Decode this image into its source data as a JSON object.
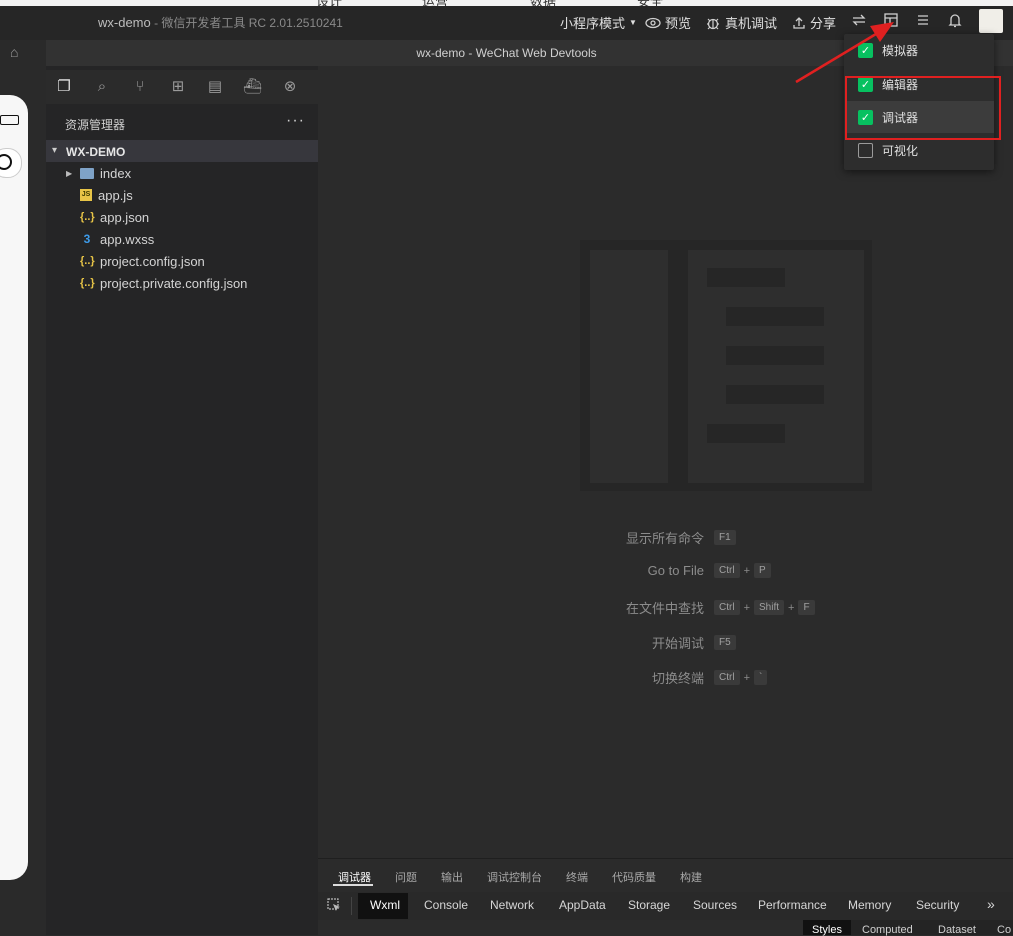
{
  "topstrip": {
    "items": [
      "设计",
      "运营",
      "数据",
      "安全"
    ]
  },
  "titlebar": {
    "app_name": "wx-demo",
    "app_sub": " - 微信开发者工具 RC 2.01.2510241",
    "mode": "小程序模式",
    "preview": "预览",
    "real_debug": "真机调试",
    "share": "分享"
  },
  "window_title": "wx-demo - WeChat Web Devtools",
  "explorer": {
    "title": "资源管理器",
    "more": "···",
    "project": "WX-DEMO",
    "files": [
      {
        "name": "index",
        "type": "folder"
      },
      {
        "name": "app.js",
        "type": "js"
      },
      {
        "name": "app.json",
        "type": "json"
      },
      {
        "name": "app.wxss",
        "type": "css"
      },
      {
        "name": "project.config.json",
        "type": "json"
      },
      {
        "name": "project.private.config.json",
        "type": "json"
      }
    ]
  },
  "shortcuts": [
    {
      "label": "显示所有命令",
      "keys": [
        "F1"
      ]
    },
    {
      "label": "Go to File",
      "keys": [
        "Ctrl",
        "P"
      ]
    },
    {
      "label": "在文件中查找",
      "keys": [
        "Ctrl",
        "Shift",
        "F"
      ]
    },
    {
      "label": "开始调试",
      "keys": [
        "F5"
      ]
    },
    {
      "label": "切换终端",
      "keys": [
        "Ctrl",
        "`"
      ]
    }
  ],
  "panel_tabs": [
    "调试器",
    "问题",
    "输出",
    "调试控制台",
    "终端",
    "代码质量",
    "构建"
  ],
  "devtools_tabs": [
    "Wxml",
    "Console",
    "Network",
    "AppData",
    "Storage",
    "Sources",
    "Performance",
    "Memory",
    "Security"
  ],
  "devtools_more": "»",
  "sub_tabs": [
    "Styles",
    "Computed",
    "Dataset",
    "Co"
  ],
  "menu": {
    "items": [
      {
        "label": "模拟器",
        "checked": true
      },
      {
        "label": "编辑器",
        "checked": true
      },
      {
        "label": "调试器",
        "checked": true
      },
      {
        "label": "可视化",
        "checked": false
      }
    ]
  },
  "colors": {
    "accent_green": "#07c160",
    "highlight_red": "#e02020"
  }
}
